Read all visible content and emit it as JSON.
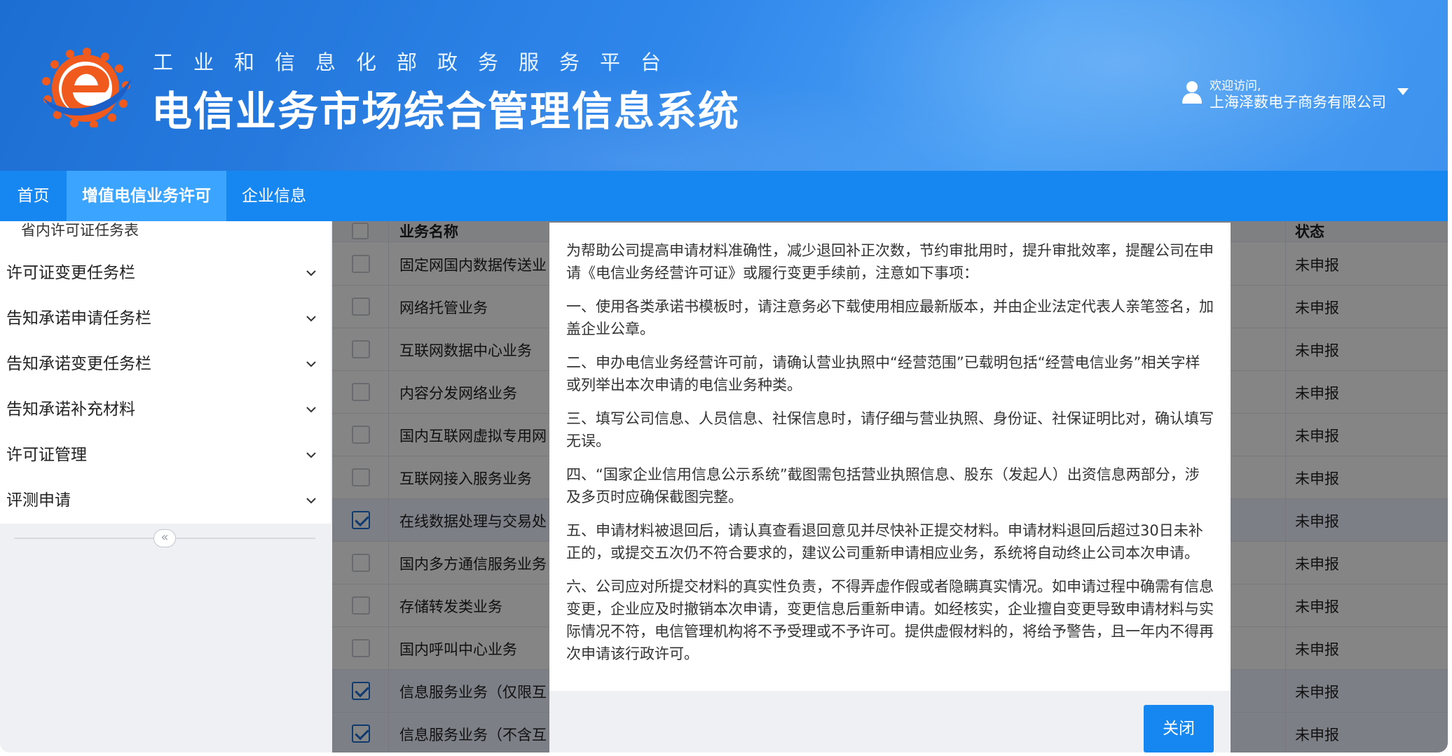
{
  "header": {
    "subtitle": "工业和信息化部政务服务平台",
    "title": "电信业务市场综合管理信息系统",
    "user": {
      "welcome": "欢迎访问,",
      "company": "上海泽薮电子商务有限公司"
    }
  },
  "nav": {
    "items": [
      {
        "label": "首页"
      },
      {
        "label": "增值电信业务许可"
      },
      {
        "label": "企业信息"
      }
    ]
  },
  "sidebar": {
    "partial_item": "省内许可证任务表",
    "items": [
      {
        "label": "许可证变更任务栏"
      },
      {
        "label": "告知承诺申请任务栏"
      },
      {
        "label": "告知承诺变更任务栏"
      },
      {
        "label": "告知承诺补充材料"
      },
      {
        "label": "许可证管理"
      },
      {
        "label": "评测申请"
      }
    ],
    "collapse_glyph": "«"
  },
  "table": {
    "headers": {
      "name": "业务名称",
      "status": "状态"
    },
    "rows": [
      {
        "name": "固定网国内数据传送业",
        "status": "未申报",
        "checked": false
      },
      {
        "name": "网络托管业务",
        "status": "未申报",
        "checked": false
      },
      {
        "name": "互联网数据中心业务",
        "status": "未申报",
        "checked": false
      },
      {
        "name": "内容分发网络业务",
        "status": "未申报",
        "checked": false
      },
      {
        "name": "国内互联网虚拟专用网",
        "status": "未申报",
        "checked": false
      },
      {
        "name": "互联网接入服务业务",
        "status": "未申报",
        "checked": false
      },
      {
        "name": "在线数据处理与交易处",
        "status": "未申报",
        "checked": true
      },
      {
        "name": "国内多方通信服务业务",
        "status": "未申报",
        "checked": false
      },
      {
        "name": "存储转发类业务",
        "status": "未申报",
        "checked": false
      },
      {
        "name": "国内呼叫中心业务",
        "status": "未申报",
        "checked": false
      },
      {
        "name": "信息服务业务（仅限互",
        "status": "未申报",
        "checked": true
      },
      {
        "name": "信息服务业务（不含互",
        "status": "未申报",
        "checked": true
      }
    ]
  },
  "modal": {
    "paragraphs": [
      "为帮助公司提高申请材料准确性，减少退回补正次数，节约审批用时，提升审批效率，提醒公司在申请《电信业务经营许可证》或履行变更手续前，注意如下事项：",
      "一、使用各类承诺书模板时，请注意务必下载使用相应最新版本，并由企业法定代表人亲笔签名，加盖企业公章。",
      "二、申办电信业务经营许可前，请确认营业执照中“经营范围”已载明包括“经营电信业务”相关字样或列举出本次申请的电信业务种类。",
      "三、填写公司信息、人员信息、社保信息时，请仔细与营业执照、身份证、社保证明比对，确认填写无误。",
      "四、“国家企业信用信息公示系统”截图需包括营业执照信息、股东（发起人）出资信息两部分，涉及多页时应确保截图完整。",
      "五、申请材料被退回后，请认真查看退回意见并尽快补正提交材料。申请材料退回后超过30日未补正的，或提交五次仍不符合要求的，建议公司重新申请相应业务，系统将自动终止公司本次申请。",
      "六、公司应对所提交材料的真实性负责，不得弄虚作假或者隐瞒真实情况。如申请过程中确需有信息变更，企业应及时撤销本次申请，变更信息后重新申请。如经核实，企业擅自变更导致申请材料与实际情况不符，电信管理机构将不予受理或不予许可。提供虚假材料的，将给予警告，且一年内不得再次申请该行政许可。"
    ],
    "close_label": "关闭"
  },
  "colors": {
    "nav_bg": "#1687f0",
    "nav_active": "#3aa4ff",
    "header_gradient_start": "#1d6ed3",
    "header_gradient_end": "#4aa0f5",
    "logo_orange": "#f05a1c",
    "logo_blue": "#1c5fc8",
    "button_primary": "#1687f0"
  },
  "icons": {
    "logo": "telecom-e-logo-icon",
    "user": "user-icon",
    "dropdown": "caret-down-icon",
    "chevron": "chevron-down-icon",
    "collapse": "double-chevron-left-icon",
    "checkbox": "checkbox-icon"
  }
}
